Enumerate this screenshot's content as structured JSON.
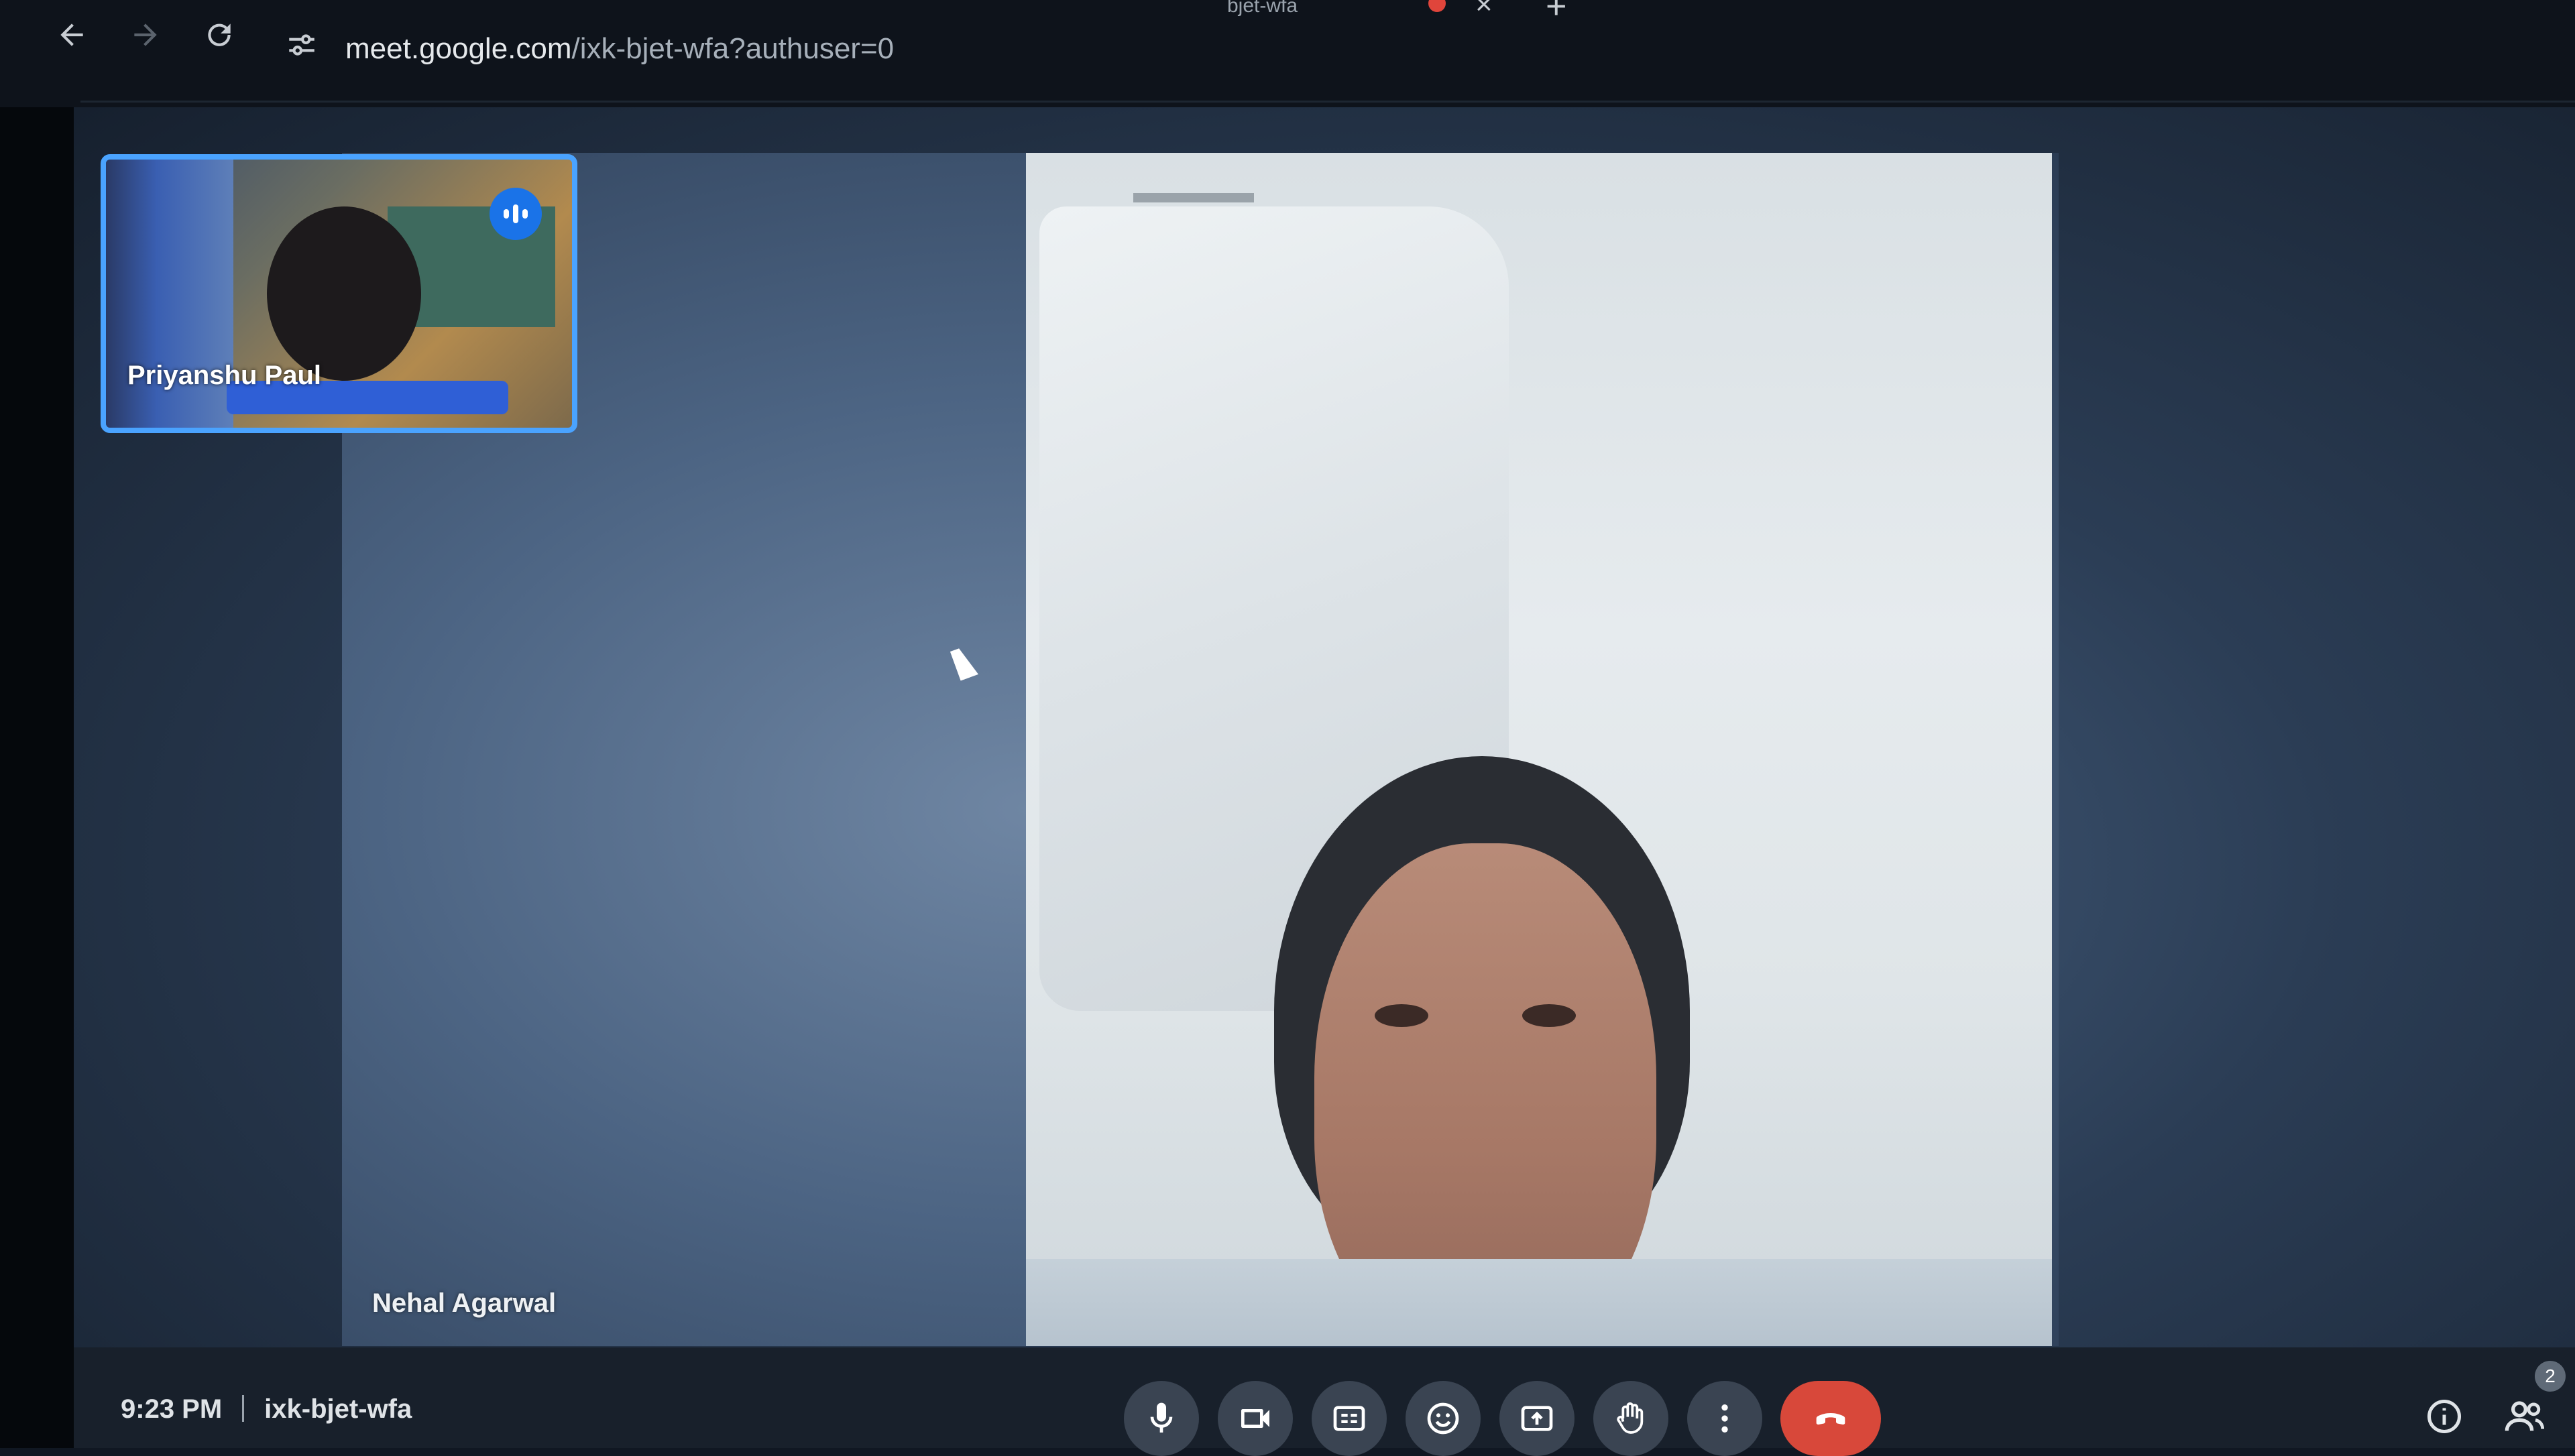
{
  "browser": {
    "tab_title": "bjet-wfa",
    "tab_close": "×",
    "tab_new": "+",
    "url_host": "meet.google.com",
    "url_path": "/ixk-bjet-wfa?authuser=0"
  },
  "participants": {
    "self": {
      "name": "Priyanshu Paul",
      "speaking": true
    },
    "main": {
      "name": "Nehal Agarwal"
    }
  },
  "meeting": {
    "time": "9:23 PM",
    "code": "ixk-bjet-wfa",
    "people_count": "2"
  },
  "controls": [
    {
      "name": "microphone",
      "icon": "mic-icon"
    },
    {
      "name": "camera",
      "icon": "camera-icon"
    },
    {
      "name": "captions",
      "icon": "captions-icon"
    },
    {
      "name": "reactions",
      "icon": "emoji-icon"
    },
    {
      "name": "present",
      "icon": "present-screen-icon"
    },
    {
      "name": "raise-hand",
      "icon": "hand-icon"
    },
    {
      "name": "more-options",
      "icon": "more-vert-icon"
    },
    {
      "name": "leave-call",
      "icon": "hangup-icon"
    }
  ],
  "colors": {
    "accent": "#4aa3ff",
    "hangup": "#d8483a",
    "speaking_badge": "#1a73e8"
  }
}
